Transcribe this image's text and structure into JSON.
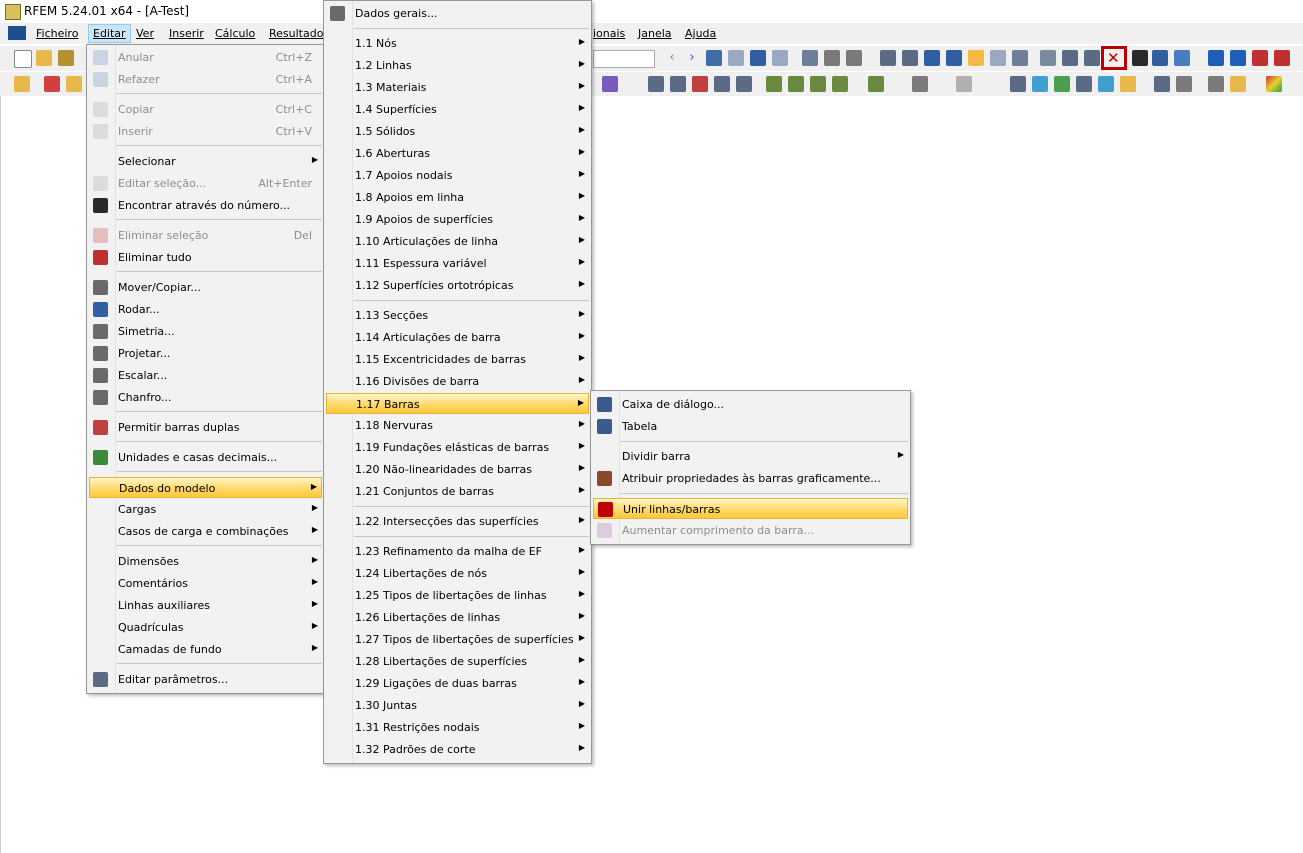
{
  "window": {
    "title": "RFEM 5.24.01 x64 - [A-Test]"
  },
  "menubar": {
    "items": [
      "Ficheiro",
      "Editar",
      "Ver",
      "Inserir",
      "Cálculo",
      "Resultados",
      "ionais",
      "Janela",
      "Ajuda"
    ]
  },
  "colors": {
    "highlight": "#ffd96b",
    "selected_toolbar_border": "#c00000"
  },
  "edit_menu": {
    "items": [
      {
        "label": "Anular",
        "shortcut": "Ctrl+Z",
        "disabled": true,
        "icon": "undo-icon"
      },
      {
        "label": "Refazer",
        "shortcut": "Ctrl+A",
        "disabled": true,
        "icon": "redo-icon"
      },
      {
        "label": "Copiar",
        "shortcut": "Ctrl+C",
        "disabled": true,
        "icon": "copy-icon"
      },
      {
        "label": "Inserir",
        "shortcut": "Ctrl+V",
        "disabled": true,
        "icon": "paste-icon"
      },
      {
        "label": "Selecionar",
        "submenu": true
      },
      {
        "label": "Editar seleção...",
        "shortcut": "Alt+Enter",
        "disabled": true,
        "icon": "edit-selection-icon"
      },
      {
        "label": "Encontrar através do número...",
        "icon": "binoculars-icon"
      },
      {
        "label": "Eliminar seleção",
        "shortcut": "Del",
        "disabled": true,
        "icon": "delete-selection-icon"
      },
      {
        "label": "Eliminar tudo",
        "icon": "delete-all-icon"
      },
      {
        "label": "Mover/Copiar...",
        "icon": "move-copy-icon"
      },
      {
        "label": "Rodar...",
        "icon": "rotate-icon"
      },
      {
        "label": "Simetria...",
        "icon": "mirror-icon"
      },
      {
        "label": "Projetar...",
        "icon": "project-icon"
      },
      {
        "label": "Escalar...",
        "icon": "scale-icon"
      },
      {
        "label": "Chanfro...",
        "icon": "chamfer-icon"
      },
      {
        "label": "Permitir barras duplas",
        "icon": "double-members-icon"
      },
      {
        "label": "Unidades e casas decimais...",
        "icon": "units-icon"
      },
      {
        "label": "Dados do modelo",
        "submenu": true,
        "highlight": true
      },
      {
        "label": "Cargas",
        "submenu": true
      },
      {
        "label": "Casos de carga e combinações",
        "submenu": true
      },
      {
        "label": "Dimensões",
        "submenu": true
      },
      {
        "label": "Comentários",
        "submenu": true
      },
      {
        "label": "Linhas auxiliares",
        "submenu": true
      },
      {
        "label": "Quadrículas",
        "submenu": true
      },
      {
        "label": "Camadas de fundo",
        "submenu": true
      },
      {
        "label": "Editar parâmetros...",
        "icon": "parameters-icon"
      }
    ]
  },
  "model_data_menu": {
    "items": [
      {
        "label": "Dados gerais...",
        "icon": "general-data-icon"
      },
      {
        "label": "1.1 Nós",
        "submenu": true
      },
      {
        "label": "1.2 Linhas",
        "submenu": true
      },
      {
        "label": "1.3 Materiais",
        "submenu": true
      },
      {
        "label": "1.4 Superfícies",
        "submenu": true
      },
      {
        "label": "1.5 Sólidos",
        "submenu": true
      },
      {
        "label": "1.6 Aberturas",
        "submenu": true
      },
      {
        "label": "1.7 Apoios nodais",
        "submenu": true
      },
      {
        "label": "1.8 Apoios em linha",
        "submenu": true
      },
      {
        "label": "1.9 Apoios de superfícies",
        "submenu": true
      },
      {
        "label": "1.10 Articulações de linha",
        "submenu": true
      },
      {
        "label": "1.11 Espessura variável",
        "submenu": true
      },
      {
        "label": "1.12 Superfícies ortotrópicas",
        "submenu": true
      },
      {
        "label": "1.13 Secções",
        "submenu": true
      },
      {
        "label": "1.14 Articulações de barra",
        "submenu": true
      },
      {
        "label": "1.15 Excentricidades de barras",
        "submenu": true
      },
      {
        "label": "1.16 Divisões de barra",
        "submenu": true
      },
      {
        "label": "1.17 Barras",
        "submenu": true,
        "highlight": true
      },
      {
        "label": "1.18 Nervuras",
        "submenu": true
      },
      {
        "label": "1.19 Fundações elásticas de barras",
        "submenu": true
      },
      {
        "label": "1.20 Não-linearidades de barras",
        "submenu": true
      },
      {
        "label": "1.21 Conjuntos de barras",
        "submenu": true
      },
      {
        "label": "1.22 Intersecções das superfícies",
        "submenu": true
      },
      {
        "label": "1.23 Refinamento da malha de EF",
        "submenu": true
      },
      {
        "label": "1.24 Libertações de nós",
        "submenu": true
      },
      {
        "label": "1.25 Tipos de libertações de linhas",
        "submenu": true
      },
      {
        "label": "1.26 Libertações de linhas",
        "submenu": true
      },
      {
        "label": "1.27 Tipos de libertações de superfícies",
        "submenu": true
      },
      {
        "label": "1.28 Libertações de superfícies",
        "submenu": true
      },
      {
        "label": "1.29 Ligações de duas barras",
        "submenu": true
      },
      {
        "label": "1.30 Juntas",
        "submenu": true
      },
      {
        "label": "1.31 Restrições nodais",
        "submenu": true
      },
      {
        "label": "1.32 Padrões de corte",
        "submenu": true
      }
    ]
  },
  "members_menu": {
    "items": [
      {
        "label": "Caixa de diálogo...",
        "icon": "member-dialog-icon"
      },
      {
        "label": "Tabela",
        "icon": "member-table-icon"
      },
      {
        "label": "Dividir barra",
        "submenu": true
      },
      {
        "label": "Atribuir propriedades às barras graficamente...",
        "icon": "assign-properties-icon"
      },
      {
        "label": "Unir linhas/barras",
        "highlight": true,
        "icon": "join-lines-icon"
      },
      {
        "label": "Aumentar comprimento da barra...",
        "disabled": true,
        "icon": "extend-member-icon"
      }
    ]
  }
}
